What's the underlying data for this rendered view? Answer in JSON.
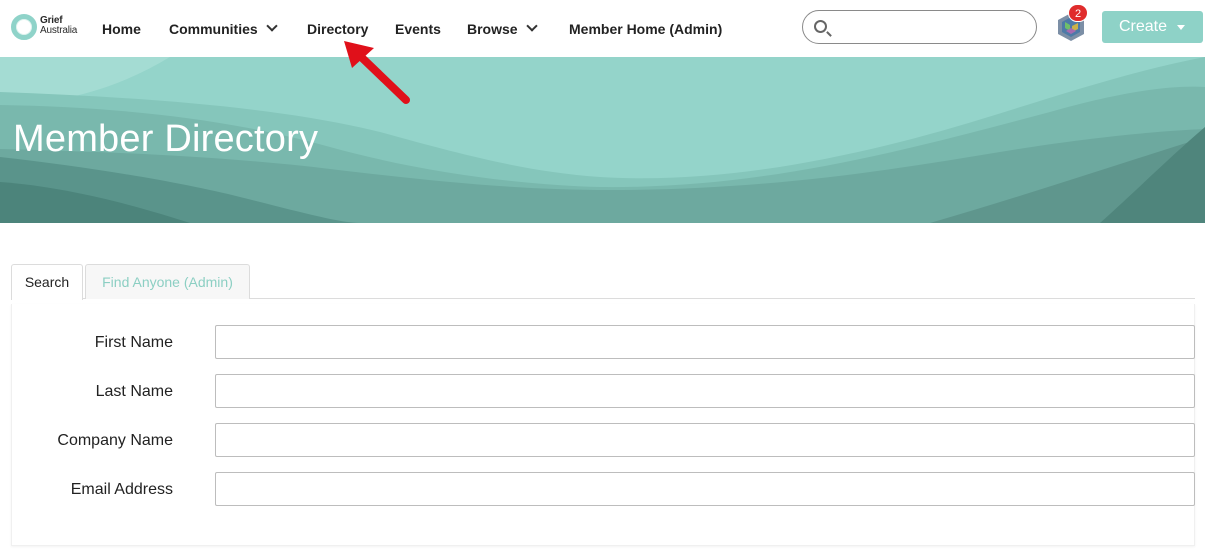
{
  "brand": {
    "line1": "Grief",
    "line2": "Australia"
  },
  "nav": {
    "home": "Home",
    "communities": "Communities",
    "directory": "Directory",
    "events": "Events",
    "browse": "Browse",
    "member_home": "Member Home (Admin)"
  },
  "search": {
    "placeholder": "",
    "value": ""
  },
  "notifications": {
    "count": "2"
  },
  "create_button": {
    "label": "Create"
  },
  "banner": {
    "title": "Member Directory"
  },
  "tabs": [
    {
      "label": "Search",
      "active": true
    },
    {
      "label": "Find Anyone (Admin)",
      "active": false
    }
  ],
  "form": {
    "fields": [
      {
        "label": "First Name",
        "value": ""
      },
      {
        "label": "Last Name",
        "value": ""
      },
      {
        "label": "Company Name",
        "value": ""
      },
      {
        "label": "Email Address",
        "value": ""
      }
    ]
  },
  "colors": {
    "accent": "#8ed2c7",
    "tab_inactive_text": "#8ccfc3",
    "badge": "#e02c2c",
    "annotation_arrow": "#e0101a"
  }
}
